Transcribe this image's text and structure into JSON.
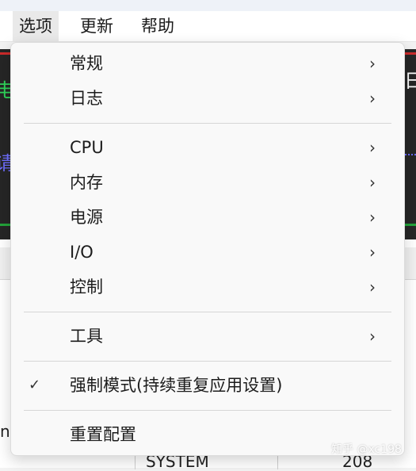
{
  "menubar": {
    "items": [
      {
        "label": "选项",
        "active": true
      },
      {
        "label": "更新"
      },
      {
        "label": "帮助"
      }
    ]
  },
  "dropdown": {
    "items": [
      {
        "label": "常规",
        "submenu": true,
        "icon": "chevron-right-icon"
      },
      {
        "label": "日志",
        "submenu": true,
        "icon": "chevron-right-icon"
      },
      {
        "label": "CPU",
        "submenu": true,
        "icon": "chevron-right-icon"
      },
      {
        "label": "内存",
        "submenu": true,
        "icon": "chevron-right-icon"
      },
      {
        "label": "电源",
        "submenu": true,
        "icon": "chevron-right-icon"
      },
      {
        "label": "I/O",
        "submenu": true,
        "icon": "chevron-right-icon"
      },
      {
        "label": "控制",
        "submenu": true,
        "icon": "chevron-right-icon"
      },
      {
        "label": "工具",
        "submenu": true,
        "icon": "chevron-right-icon"
      },
      {
        "label": "强制模式(持续重复应用设置)",
        "checked": true,
        "icon": "checkmark-icon"
      },
      {
        "label": "重置配置"
      }
    ]
  },
  "glyphs": {
    "chevron": "›",
    "check": "✓"
  },
  "background": {
    "partial_text_left_green": "电",
    "partial_text_left_blue": "请",
    "partial_text_right": "日",
    "bottom_cell_1": "SYSTEM",
    "bottom_cell_2": "208",
    "bottom_left_partial": "n",
    "colors": {
      "graph_bg": "#262626",
      "red_line": "#cc2b2b",
      "green_line": "#23a23a",
      "blue_dots": "#6a6aff",
      "green_text": "#2fd45a",
      "blue_text": "#6f6fff"
    }
  },
  "watermark": "知乎 @xc198"
}
